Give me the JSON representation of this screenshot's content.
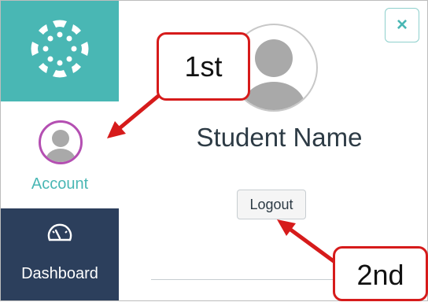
{
  "sidebar": {
    "account_label": "Account",
    "dashboard_label": "Dashboard"
  },
  "profile": {
    "student_name": "Student Name",
    "logout_label": "Logout",
    "close_label": "×"
  },
  "callouts": {
    "first": "1st",
    "second": "2nd"
  },
  "icons": [
    "canvas-logo-icon",
    "avatar-icon",
    "dashboard-gauge-icon",
    "close-icon",
    "arrow-icon"
  ],
  "colors": {
    "brand_teal": "#49b7b4",
    "sidebar_navy": "#2c3f5c",
    "avatar_ring": "#b44fb2",
    "callout_red": "#d61b1b"
  }
}
